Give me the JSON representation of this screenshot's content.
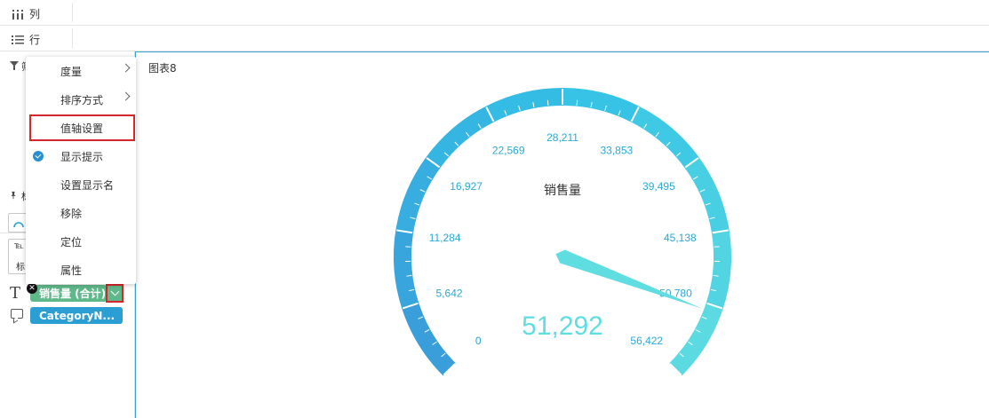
{
  "shelves": {
    "columns_label": "列",
    "rows_label": "行"
  },
  "chart": {
    "title": "图表8",
    "gauge_label": "销售量",
    "value_display": "51,292"
  },
  "chart_data": {
    "type": "gauge",
    "title": "图表8",
    "series": [
      {
        "name": "销售量",
        "value": 51292
      }
    ],
    "min": 0,
    "max": 56422,
    "tick_labels": [
      "0",
      "5,642",
      "11,284",
      "16,927",
      "22,569",
      "28,211",
      "33,853",
      "39,495",
      "45,138",
      "50,780",
      "56,422"
    ],
    "colors": {
      "band_start": "#3a9ad9",
      "band_mid": "#33c0e6",
      "band_end": "#5fdde0",
      "pointer": "#5fdde0",
      "value_text": "#5fdde0",
      "tick_text": "#2aa8d6"
    }
  },
  "context_menu": {
    "items": [
      {
        "label": "度量",
        "has_submenu": true,
        "checked": false
      },
      {
        "label": "排序方式",
        "has_submenu": true,
        "checked": false
      },
      {
        "label": "值轴设置",
        "has_submenu": false,
        "checked": false,
        "highlighted": true
      },
      {
        "label": "显示提示",
        "has_submenu": false,
        "checked": true
      },
      {
        "label": "设置显示名",
        "has_submenu": false,
        "checked": false
      },
      {
        "label": "移除",
        "has_submenu": false,
        "checked": false
      },
      {
        "label": "定位",
        "has_submenu": false,
        "checked": false
      },
      {
        "label": "属性",
        "has_submenu": false,
        "checked": false
      }
    ]
  },
  "fields": {
    "text_field": "销售量 (合计)",
    "tooltip_field": "CategoryN..."
  },
  "left_partial": {
    "filter_char": "筛",
    "mark_char": "标",
    "mark_small": "标"
  },
  "colors": {
    "accent": "#2b9fd3",
    "green_pill": "#5fb88a",
    "highlight_border": "#d6252b"
  }
}
